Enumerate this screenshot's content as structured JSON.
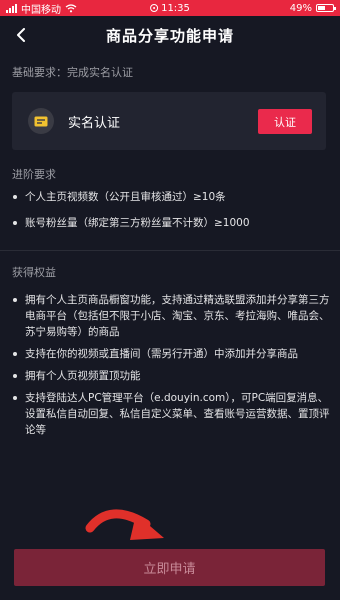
{
  "status_bar": {
    "carrier": "中国移动",
    "time": "11:35",
    "battery": "49%",
    "battery_level": 0.49
  },
  "header": {
    "title": "商品分享功能申请"
  },
  "basic": {
    "label": "基础要求：完成实名认证",
    "card_title": "实名认证",
    "button_label": "认证"
  },
  "advanced": {
    "label": "进阶要求",
    "items": [
      "个人主页视频数（公开且审核通过）≥10条",
      "账号粉丝量（绑定第三方粉丝量不计数）≥1000"
    ]
  },
  "benefits": {
    "label": "获得权益",
    "items": [
      "拥有个人主页商品橱窗功能，支持通过精选联盟添加并分享第三方电商平台（包括但不限于小店、淘宝、京东、考拉海购、唯品会、苏宁易购等）的商品",
      "支持在你的视频或直播间（需另行开通）中添加并分享商品",
      "拥有个人页视频置顶功能",
      "支持登陆达人PC管理平台（e.douyin.com），可PC端回复消息、设置私信自动回复、私信自定义菜单、查看账号运营数据、置顶评论等"
    ]
  },
  "footer": {
    "apply_label": "立即申请"
  },
  "colors": {
    "status_bar": "#e8273f",
    "background": "#161823",
    "accent": "#ea2a4c",
    "apply_button": "#7a2438",
    "arrow": "#e0302a"
  }
}
